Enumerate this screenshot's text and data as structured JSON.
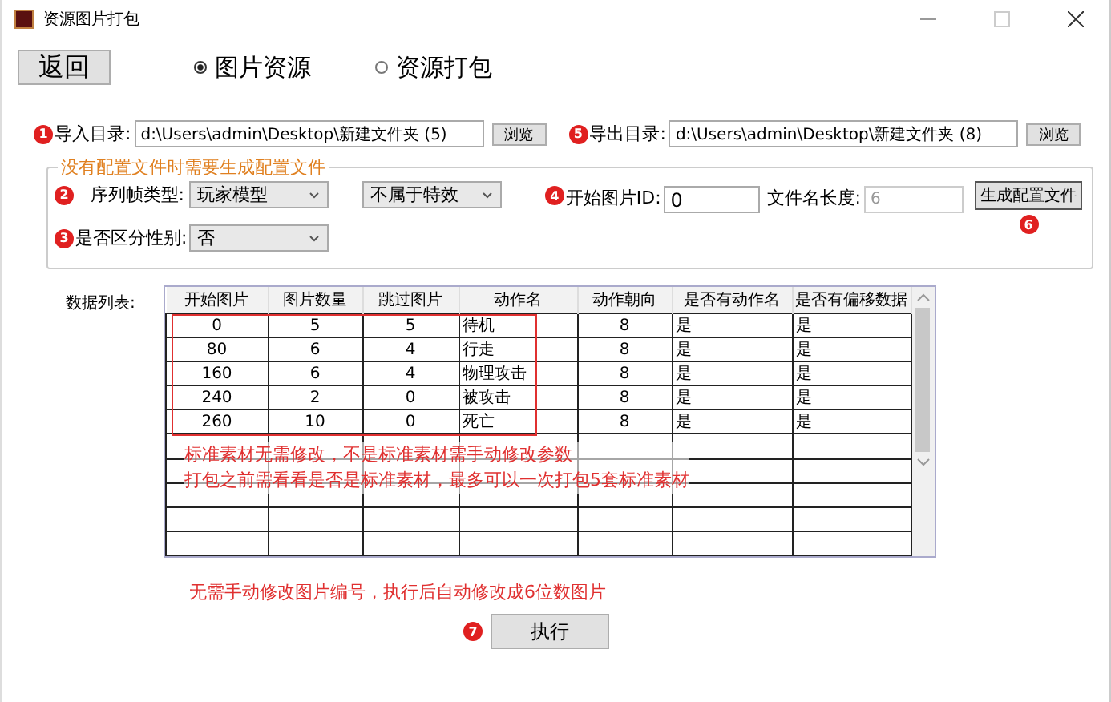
{
  "window": {
    "title": "资源图片打包"
  },
  "back_button": "返回",
  "modes": [
    {
      "label": "图片资源",
      "selected": true
    },
    {
      "label": "资源打包",
      "selected": false
    }
  ],
  "paths": [
    {
      "badge": "1",
      "label": "导入目录:",
      "value": "d:\\Users\\admin\\Desktop\\新建文件夹 (5)",
      "button": "浏览"
    },
    {
      "badge": "5",
      "label": "导出目录:",
      "value": "d:\\Users\\admin\\Desktop\\新建文件夹 (8)",
      "button": "浏览"
    }
  ],
  "config": {
    "legend": "没有配置文件时需要生成配置文件",
    "frame_type": {
      "badge": "2",
      "label": "序列帧类型:",
      "value": "玩家模型"
    },
    "effect": {
      "value": "不属于特效"
    },
    "start_id": {
      "badge": "4",
      "label": "开始图片ID:",
      "value": "0"
    },
    "name_length": {
      "label": "文件名长度:",
      "value": "6",
      "disabled": true
    },
    "generate": {
      "label": "生成配置文件",
      "badge": "6"
    },
    "gender": {
      "badge": "3",
      "label": "是否区分性别:",
      "value": "否"
    }
  },
  "table": {
    "label": "数据列表:",
    "columns": [
      "开始图片",
      "图片数量",
      "跳过图片",
      "动作名",
      "动作朝向",
      "是否有动作名",
      "是否有偏移数据"
    ],
    "rows": [
      [
        "0",
        "5",
        "5",
        "待机",
        "8",
        "是",
        "是"
      ],
      [
        "80",
        "6",
        "4",
        "行走",
        "8",
        "是",
        "是"
      ],
      [
        "160",
        "6",
        "4",
        "物理攻击",
        "8",
        "是",
        "是"
      ],
      [
        "240",
        "2",
        "0",
        "被攻击",
        "8",
        "是",
        "是"
      ],
      [
        "260",
        "10",
        "0",
        "死亡",
        "8",
        "是",
        "是"
      ]
    ],
    "annotations": [
      "标准素材无需修改，不是标准素材需手动修改参数",
      "打包之前需看看是否是标准素材，最多可以一次打包5套标准素材"
    ]
  },
  "note": "无需手动修改图片编号，执行后自动修改成6位数图片",
  "execute": {
    "badge": "7",
    "label": "执行"
  }
}
